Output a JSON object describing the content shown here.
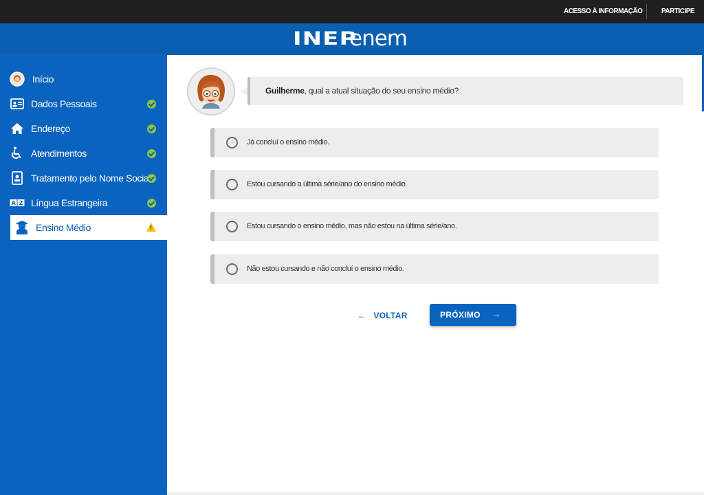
{
  "topbar": {
    "links": [
      "ACESSO À INFORMAÇÃO",
      "PARTICIPE"
    ]
  },
  "brand": {
    "logo_left": "INEP",
    "logo_right": "enem",
    "color": "#0a5fb0"
  },
  "sidebar": {
    "items": [
      {
        "label": "Início",
        "icon": "avatar-icon",
        "status": "none"
      },
      {
        "label": "Dados Pessoais",
        "icon": "id-card-icon",
        "status": "complete"
      },
      {
        "label": "Endereço",
        "icon": "home-icon",
        "status": "complete"
      },
      {
        "label": "Atendimentos",
        "icon": "wheelchair-icon",
        "status": "complete"
      },
      {
        "label": "Tratamento pelo Nome Social",
        "icon": "badge-icon",
        "status": "complete"
      },
      {
        "label": "Língua Estrangeira",
        "icon": "translate-icon",
        "status": "complete"
      },
      {
        "label": "Ensino Médio",
        "icon": "graduate-icon",
        "status": "warning",
        "active": true
      }
    ]
  },
  "question": {
    "name": "Guilherme",
    "text": ", qual a atual situação do seu ensino médio?"
  },
  "options": [
    "Já concluí o ensino médio.",
    "Estou cursando a última série/ano do ensino médio.",
    "Estou cursando o ensino médio, mas não estou na última série/ano.",
    "Não estou cursando e não concluí o ensino médio."
  ],
  "buttons": {
    "back_label": "VOLTAR",
    "next_label": "PRÓXIMO"
  },
  "colors": {
    "primary": "#0a63be",
    "success": "#8dc63f",
    "warning": "#f2c200"
  }
}
